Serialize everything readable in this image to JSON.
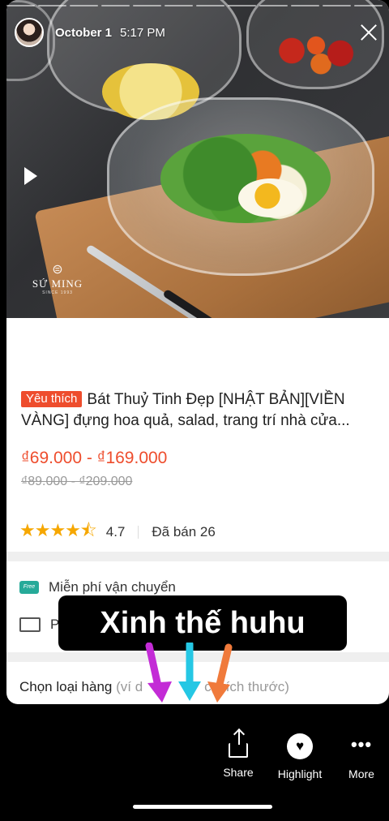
{
  "story": {
    "username": "October 1",
    "time": "5:17 PM",
    "caption": "Xinh thế huhu"
  },
  "product": {
    "brand": "SỨ MING",
    "brand_sub": "SINCE 1993",
    "badge": "Yêu thích",
    "title": "Bát Thuỷ Tinh Đẹp [NHẬT BẢN][VIỀN VÀNG] đựng hoa quả, salad, trang trí nhà cửa...",
    "price": "₫69.000 - ₫169.000",
    "old_price": "₫89.000 - ₫209.000",
    "stars": "★★★★⯪",
    "rating": "4.7",
    "sold": "Đã bán 26",
    "shipping_badge": "Free",
    "shipping": "Miễn phí vận chuyển",
    "delivery": "P",
    "variant_label": "Chọn loại hàng",
    "variant_hint": "(ví d",
    "variant_hint_tail": "c, kích thước)"
  },
  "actions": {
    "share": "Share",
    "highlight": "Highlight",
    "more": "More"
  },
  "colors": {
    "accent": "#ee4d2d",
    "stars": "#f6a700",
    "shipping": "#26aa99",
    "arrow_purple": "#c32bd6",
    "arrow_cyan": "#25c7e4",
    "arrow_orange": "#f07a3b"
  }
}
